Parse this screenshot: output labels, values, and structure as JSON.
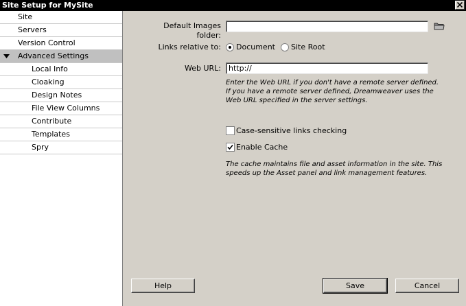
{
  "window": {
    "title": "Site Setup for MySite",
    "close_icon": "close-icon"
  },
  "sidebar": {
    "items": [
      {
        "label": "Site",
        "level": "top",
        "selected": false
      },
      {
        "label": "Servers",
        "level": "top",
        "selected": false
      },
      {
        "label": "Version Control",
        "level": "top",
        "selected": false
      },
      {
        "label": "Advanced Settings",
        "level": "top",
        "selected": true,
        "expanded": true
      },
      {
        "label": "Local Info",
        "level": "sub",
        "selected": false
      },
      {
        "label": "Cloaking",
        "level": "sub",
        "selected": false
      },
      {
        "label": "Design Notes",
        "level": "sub",
        "selected": false
      },
      {
        "label": "File View Columns",
        "level": "sub",
        "selected": false
      },
      {
        "label": "Contribute",
        "level": "sub",
        "selected": false
      },
      {
        "label": "Templates",
        "level": "sub",
        "selected": false
      },
      {
        "label": "Spry",
        "level": "sub",
        "selected": false
      }
    ]
  },
  "form": {
    "default_images": {
      "label": "Default Images folder:",
      "value": ""
    },
    "links_relative": {
      "label": "Links relative to:",
      "options": [
        "Document",
        "Site Root"
      ],
      "selected": "Document"
    },
    "web_url": {
      "label": "Web URL:",
      "value": "http://",
      "help": "Enter the Web URL if you don't have a remote server defined. If you have a remote server defined, Dreamweaver uses the Web URL specified in the server settings."
    },
    "case_sensitive": {
      "label": "Case-sensitive links checking",
      "checked": false
    },
    "enable_cache": {
      "label": "Enable Cache",
      "checked": true,
      "help": "The cache maintains file and asset information in the site. This speeds up the Asset panel and link management features."
    }
  },
  "buttons": {
    "help": "Help",
    "save": "Save",
    "cancel": "Cancel"
  }
}
